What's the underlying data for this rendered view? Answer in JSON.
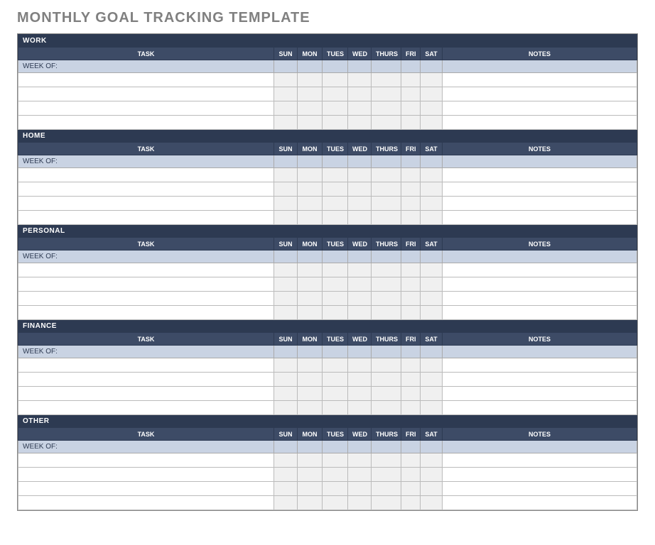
{
  "title": "MONTHLY GOAL TRACKING TEMPLATE",
  "columns": {
    "task": "TASK",
    "days": [
      "SUN",
      "MON",
      "TUES",
      "WED",
      "THURS",
      "FRI",
      "SAT"
    ],
    "notes": "NOTES"
  },
  "week_of_label": "WEEK OF:",
  "sections": [
    {
      "name": "WORK",
      "rows": [
        "",
        "",
        "",
        ""
      ]
    },
    {
      "name": "HOME",
      "rows": [
        "",
        "",
        "",
        ""
      ]
    },
    {
      "name": "PERSONAL",
      "rows": [
        "",
        "",
        "",
        ""
      ]
    },
    {
      "name": "FINANCE",
      "rows": [
        "",
        "",
        "",
        ""
      ]
    },
    {
      "name": "OTHER",
      "rows": [
        "",
        "",
        "",
        ""
      ]
    }
  ]
}
